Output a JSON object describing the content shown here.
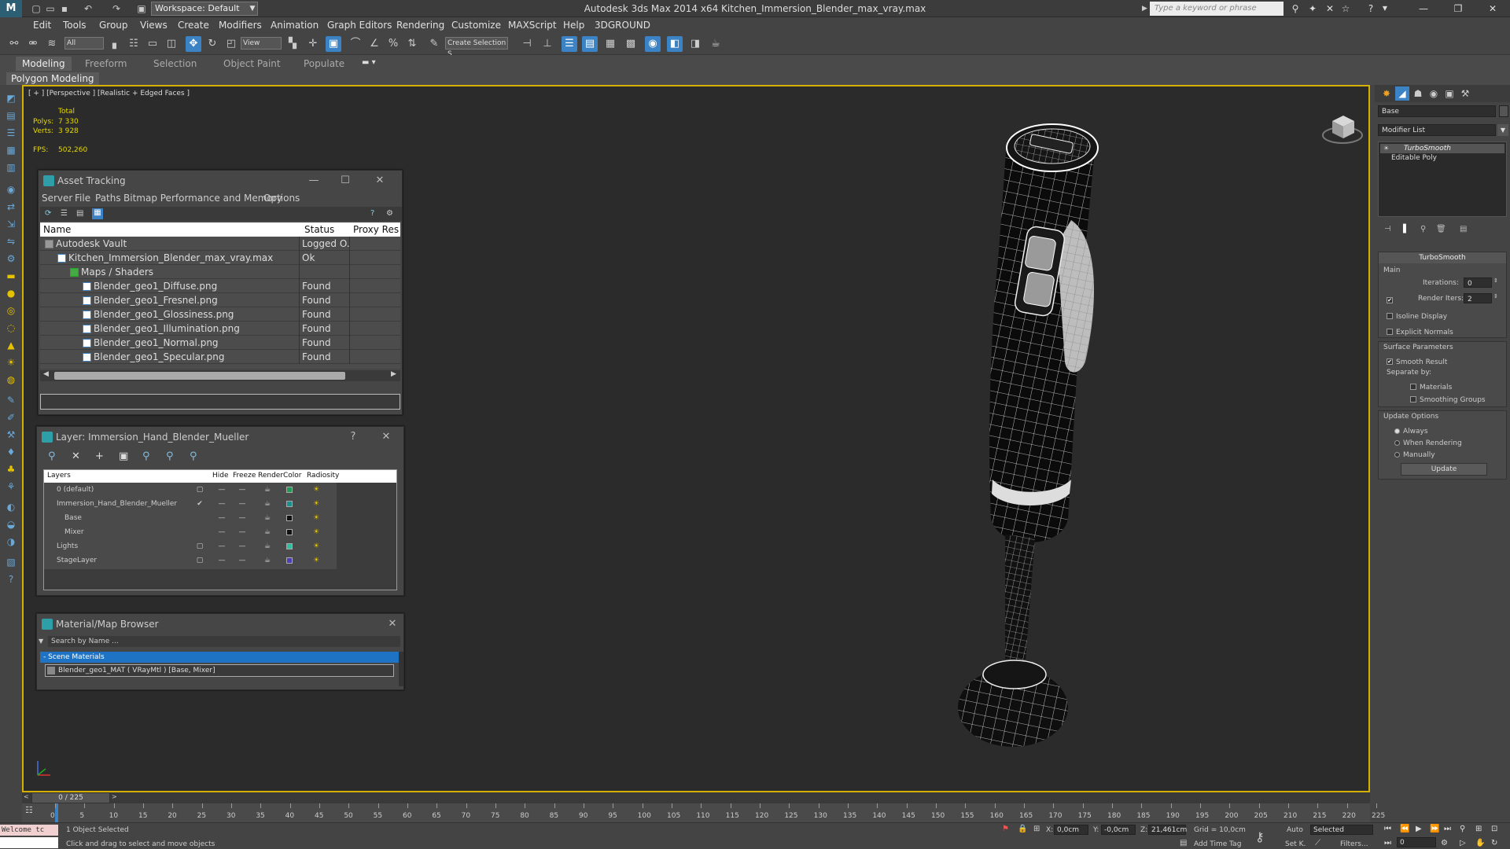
{
  "titlebar": {
    "workspace_label": "Workspace: Default",
    "app_title": "Autodesk 3ds Max  2014 x64     Kitchen_Immersion_Blender_max_vray.max",
    "search_placeholder": "Type a keyword or phrase"
  },
  "menu": [
    "Edit",
    "Tools",
    "Group",
    "Views",
    "Create",
    "Modifiers",
    "Animation",
    "Graph Editors",
    "Rendering",
    "Customize",
    "MAXScript",
    "Help",
    "3DGROUND"
  ],
  "toolbar": {
    "filter_select": "All",
    "refcoord_select": "View",
    "named_selection": "Create Selection S"
  },
  "ribbon": {
    "tabs": [
      "Modeling",
      "Freeform",
      "Selection",
      "Object Paint",
      "Populate"
    ],
    "sub_label": "Polygon Modeling"
  },
  "viewport": {
    "label": "[ + ] [Perspective ] [Realistic + Edged Faces ]",
    "stats_header": "Total",
    "polys_label": "Polys:",
    "polys_value": "7 330",
    "verts_label": "Verts:",
    "verts_value": "3 928",
    "fps_label": "FPS:",
    "fps_value": "502,260"
  },
  "asset_tracking": {
    "title": "Asset Tracking",
    "menu": [
      "Server",
      "File",
      "Paths",
      "Bitmap Performance and Memory",
      "Options"
    ],
    "columns": [
      "Name",
      "Status",
      "Proxy Res..."
    ],
    "rows": [
      {
        "name": "Autodesk Vault",
        "status": "Logged O...",
        "proxy": "",
        "indent": 0,
        "kind": "vault"
      },
      {
        "name": "Kitchen_Immersion_Blender_max_vray.max",
        "status": "Ok",
        "proxy": "",
        "indent": 1,
        "kind": "max"
      },
      {
        "name": "Maps / Shaders",
        "status": "",
        "proxy": "",
        "indent": 2,
        "kind": "folder"
      },
      {
        "name": "Blender_geo1_Diffuse.png",
        "status": "Found",
        "proxy": "",
        "indent": 3,
        "kind": "file"
      },
      {
        "name": "Blender_geo1_Fresnel.png",
        "status": "Found",
        "proxy": "",
        "indent": 3,
        "kind": "file"
      },
      {
        "name": "Blender_geo1_Glossiness.png",
        "status": "Found",
        "proxy": "",
        "indent": 3,
        "kind": "file"
      },
      {
        "name": "Blender_geo1_Illumination.png",
        "status": "Found",
        "proxy": "",
        "indent": 3,
        "kind": "file"
      },
      {
        "name": "Blender_geo1_Normal.png",
        "status": "Found",
        "proxy": "",
        "indent": 3,
        "kind": "file"
      },
      {
        "name": "Blender_geo1_Specular.png",
        "status": "Found",
        "proxy": "",
        "indent": 3,
        "kind": "file"
      }
    ]
  },
  "layer_panel": {
    "title": "Layer: Immersion_Hand_Blender_Mueller",
    "help": "?",
    "columns": [
      "Layers",
      "Hide",
      "Freeze",
      "Render",
      "Color",
      "Radiosity"
    ],
    "rows": [
      {
        "name": "0 (default)",
        "indent": 1,
        "color": "#1f9a55",
        "current": false,
        "box": true
      },
      {
        "name": "Immersion_Hand_Blender_Mueller",
        "indent": 1,
        "color": "#1a8f8f",
        "current": true,
        "box": false
      },
      {
        "name": "Base",
        "indent": 2,
        "color": "#111111",
        "current": false,
        "box": false
      },
      {
        "name": "Mixer",
        "indent": 2,
        "color": "#111111",
        "current": false,
        "box": false
      },
      {
        "name": "Lights",
        "indent": 1,
        "color": "#2fbf9f",
        "current": false,
        "box": true
      },
      {
        "name": "StageLayer",
        "indent": 1,
        "color": "#4a3fb5",
        "current": false,
        "box": true
      }
    ]
  },
  "material_browser": {
    "title": "Material/Map Browser",
    "search_placeholder": "Search by Name ...",
    "group": "- Scene Materials",
    "item": "Blender_geo1_MAT ( VRayMtl ) [Base, Mixer]"
  },
  "command_panel": {
    "object_name": "Base",
    "modifier_list": "Modifier List",
    "stack": [
      "TurboSmooth",
      "Editable Poly"
    ],
    "rollout_title": "TurboSmooth",
    "main_label": "Main",
    "iterations_label": "Iterations:",
    "iterations_value": "0",
    "render_iters_label": "Render Iters:",
    "render_iters_value": "2",
    "isoline_label": "Isoline Display",
    "explicit_normals_label": "Explicit Normals",
    "surface_params_label": "Surface Parameters",
    "smooth_result_label": "Smooth Result",
    "separate_by_label": "Separate by:",
    "materials_label": "Materials",
    "smoothing_groups_label": "Smoothing Groups",
    "update_options_label": "Update Options",
    "always_label": "Always",
    "when_rendering_label": "When Rendering",
    "manually_label": "Manually",
    "update_button": "Update"
  },
  "timeline": {
    "slider_label": "0 / 225",
    "ticks": [
      "0",
      "5",
      "10",
      "15",
      "20",
      "25",
      "30",
      "35",
      "40",
      "45",
      "50",
      "55",
      "60",
      "65",
      "70",
      "75",
      "80",
      "85",
      "90",
      "95",
      "100",
      "105",
      "110",
      "115",
      "120",
      "125",
      "130",
      "135",
      "140",
      "145",
      "150",
      "155",
      "160",
      "165",
      "170",
      "175",
      "180",
      "185",
      "190",
      "195",
      "200",
      "205",
      "210",
      "215",
      "220",
      "225"
    ]
  },
  "statusbar": {
    "maxscript_text": "Welcome tc",
    "selection_status": "1 Object Selected",
    "prompt": "Click and drag to select and move objects",
    "x_label": "X:",
    "x_value": "0,0cm",
    "y_label": "Y:",
    "y_value": "-0,0cm",
    "z_label": "Z:",
    "z_value": "21,461cm",
    "grid": "Grid = 10,0cm",
    "add_time_tag": "Add Time Tag",
    "auto_label": "Auto",
    "selected_select": "Selected",
    "setk_label": "Set K.",
    "filters_label": "Filters...",
    "frame_value": "0"
  },
  "colors": {
    "accent": "#3b83c4",
    "viewport_border": "#d4b000",
    "stats_yellow": "#e6d800"
  }
}
